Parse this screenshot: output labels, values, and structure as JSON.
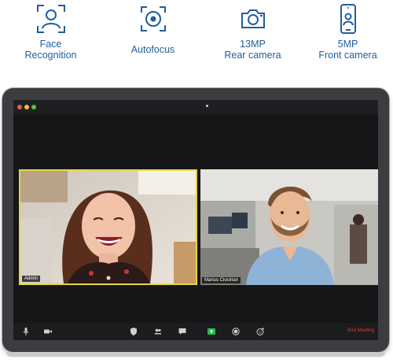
{
  "features": [
    {
      "icon": "face-recognition-icon",
      "line1": "Face",
      "line2": "Recognition"
    },
    {
      "icon": "autofocus-icon",
      "line1": "Autofocus",
      "line2": ""
    },
    {
      "icon": "rear-camera-icon",
      "line1": "13MP",
      "line2": "Rear camera"
    },
    {
      "icon": "front-camera-phone-icon",
      "line1": "5MP",
      "line2": "Front camera"
    }
  ],
  "meeting": {
    "participants": [
      {
        "name": "Admin",
        "active_speaker": true
      },
      {
        "name": "Marius Ciocirlan",
        "active_speaker": false
      }
    ],
    "toolbar": {
      "end_label": "End Meeting",
      "icons": [
        "microphone-icon",
        "video-camera-icon",
        "security-icon",
        "participants-icon",
        "chat-icon",
        "share-screen-icon",
        "record-icon",
        "reactions-icon"
      ]
    }
  },
  "colors": {
    "feature_blue": "#1f5f9c",
    "active_speaker_border": "#e6d542",
    "end_meeting": "#e53935",
    "share_green": "#2eb84b",
    "traffic_red": "#ee5a52",
    "traffic_yellow": "#f5be2e",
    "traffic_green": "#55c83c"
  }
}
